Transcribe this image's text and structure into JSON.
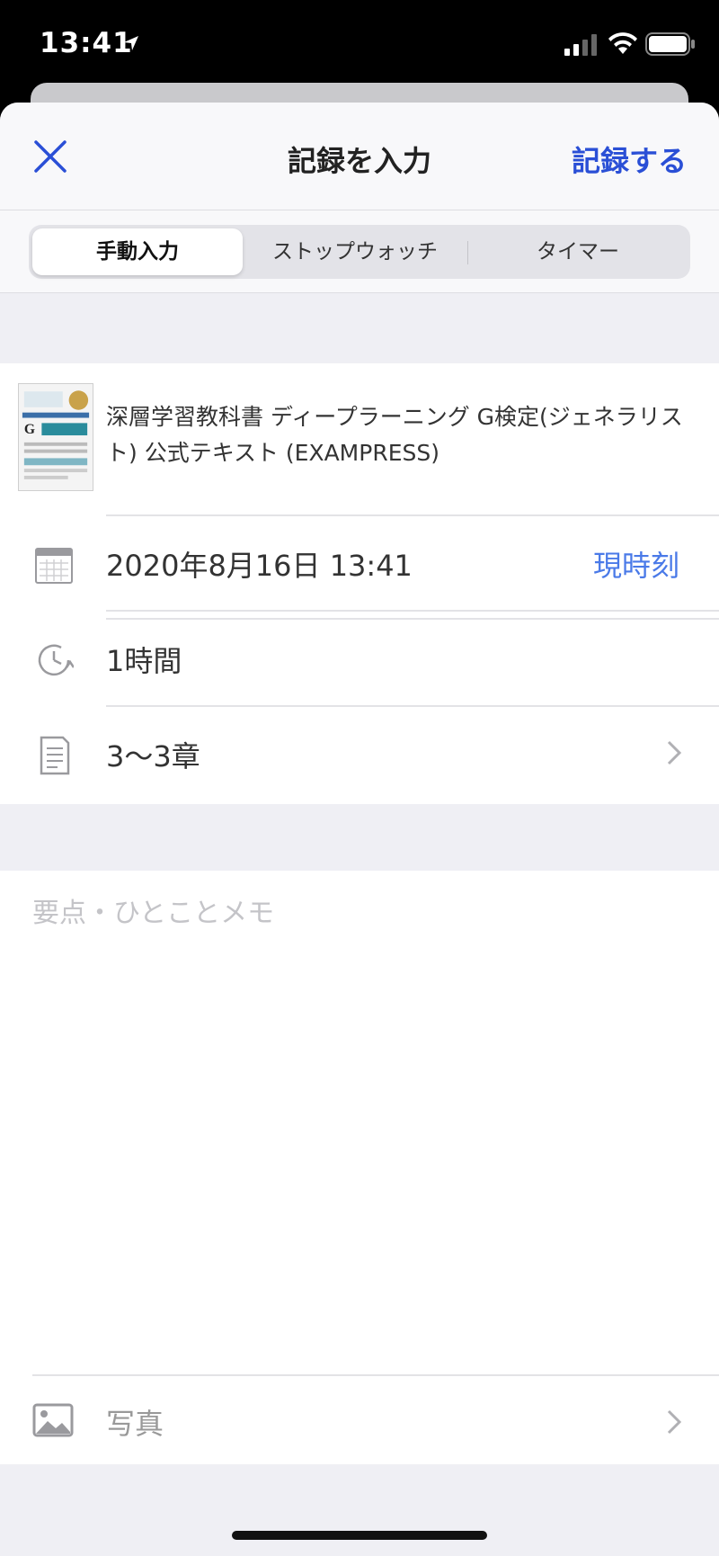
{
  "status_bar": {
    "time": "13:41"
  },
  "nav": {
    "close_icon": "close-icon",
    "title": "記録を入力",
    "save_label": "記録する",
    "accent_color": "#2a4fd6"
  },
  "segments": [
    {
      "label": "手動入力",
      "selected": true
    },
    {
      "label": "ストップウォッチ",
      "selected": false
    },
    {
      "label": "タイマー",
      "selected": false
    }
  ],
  "book": {
    "title": "深層学習教科書 ディープラーニング G検定(ジェネラリスト) 公式テキスト (EXAMPRESS)",
    "cover_icon": "book-cover-image"
  },
  "record": {
    "datetime": "2020年8月16日 13:41",
    "now_label": "現時刻",
    "duration": "1時間",
    "range": "3〜3章"
  },
  "memo": {
    "placeholder": "要点・ひとことメモ",
    "value": ""
  },
  "photo": {
    "label": "写真",
    "icon": "photo-icon"
  }
}
